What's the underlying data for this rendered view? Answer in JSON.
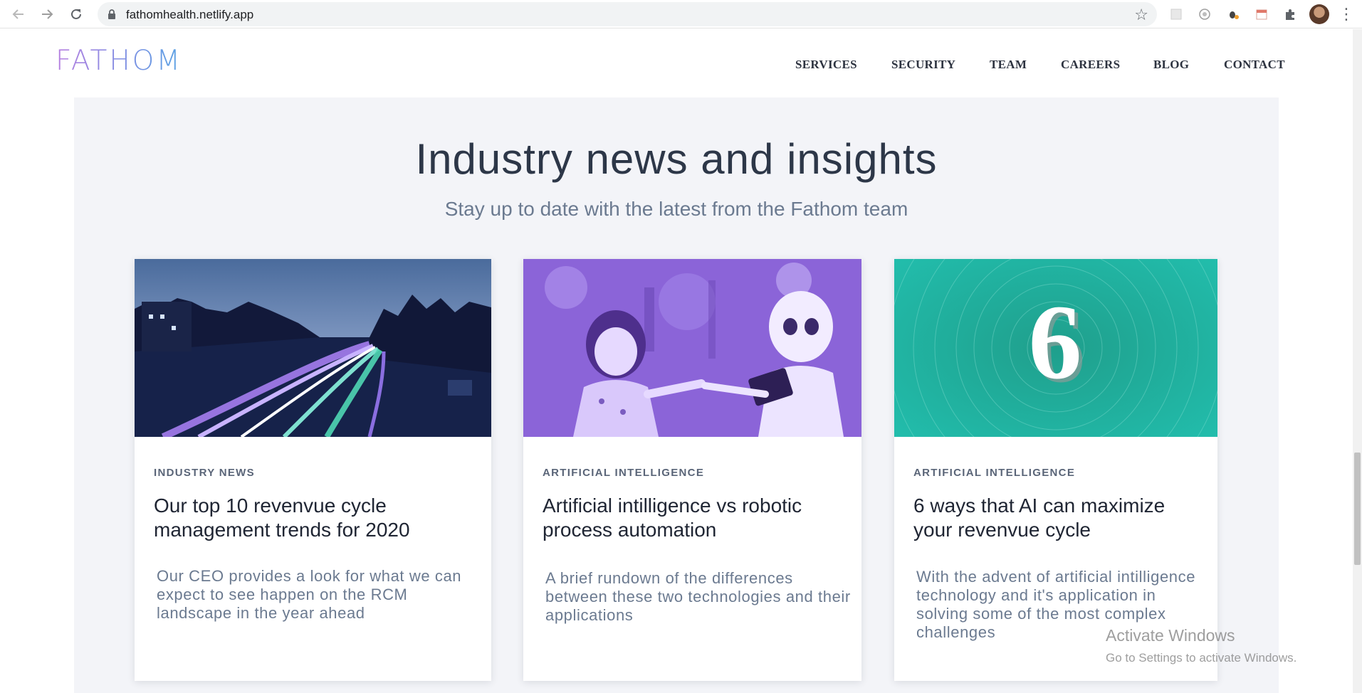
{
  "browser": {
    "url": "fathomhealth.netlify.app",
    "back_icon": "arrow-left-icon",
    "forward_icon": "arrow-right-icon",
    "reload_icon": "reload-icon",
    "bookmark_icon": "star-icon"
  },
  "site": {
    "logo": "FATHOM",
    "nav": [
      "SERVICES",
      "SECURITY",
      "TEAM",
      "CAREERS",
      "BLOG",
      "CONTACT"
    ]
  },
  "news": {
    "title": "Industry news and insights",
    "subtitle": "Stay up to date with the latest from the Fathom team",
    "cards": [
      {
        "category": "INDUSTRY NEWS",
        "title": "Our top 10 revenvue cycle management trends for 2020",
        "excerpt": "Our CEO provides a look for what we can expect to see happen on the RCM landscape in the year ahead",
        "image": "highway-light-trails-photo"
      },
      {
        "category": "ARTIFICIAL INTELLIGENCE",
        "title": "Artificial intilligence vs robotic process automation",
        "excerpt": "A brief rundown of the differences between these two technologies and their applications",
        "image": "child-and-robot-photo"
      },
      {
        "category": "ARTIFICIAL INTELLIGENCE",
        "title": "6 ways that AI can maximize your revenvue cycle",
        "excerpt": "With the advent of artificial intilligence technology and it's application in solving some of the most complex challenges",
        "image": "number-six-swirl-graphic",
        "image_text": "6"
      }
    ]
  },
  "watermark": {
    "line1": "Activate Windows",
    "line2": "Go to Settings to activate Windows."
  },
  "colors": {
    "section_bg": "#f3f4f8",
    "heading": "#2d3748",
    "muted": "#6b7a90",
    "logo_gradient_start": "#b77fe0",
    "logo_gradient_end": "#5aa3e4"
  }
}
